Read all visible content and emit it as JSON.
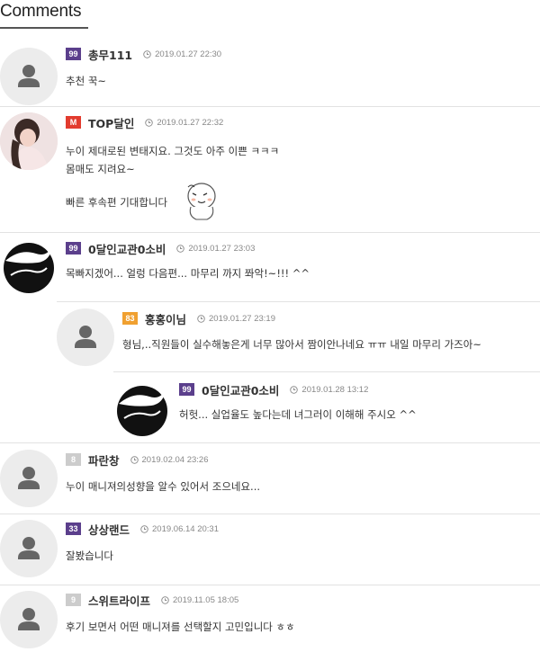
{
  "section": {
    "title": "Comments"
  },
  "colors": {
    "badge_level_99": "#5b3f8c",
    "badge_level_83": "#f0a030",
    "badge_level_8": "#cccccc",
    "badge_level_33": "#5b3f8c",
    "badge_level_9": "#cccccc",
    "badge_m": "#e23b2e"
  },
  "comments": [
    {
      "level": "99",
      "nick": "총무111",
      "date": "2019.01.27 22:30",
      "lines": [
        "추천 꾹~"
      ]
    },
    {
      "level": "M",
      "nick": "TOP달인",
      "date": "2019.01.27 22:32",
      "lines": [
        "누이 제대로된 변태지요. 그것도 아주 이쁜 ㅋㅋㅋ",
        "몸매도 지려요~",
        "빠른 후속편 기대합니다"
      ]
    },
    {
      "level": "99",
      "nick": "0달인교관0소비",
      "date": "2019.01.27 23:03",
      "lines": [
        "목빠지겠어... 얼렁 다음편... 마무리 까지 쫘악!~!!! ^^"
      ]
    },
    {
      "level": "83",
      "nick": "홍홍이님",
      "date": "2019.01.27 23:19",
      "lines": [
        "형님,..직원들이 실수해놓은게 너무 많아서 짬이안나네요 ㅠㅠ 내일 마무리 가즈아~"
      ]
    },
    {
      "level": "99",
      "nick": "0달인교관0소비",
      "date": "2019.01.28 13:12",
      "lines": [
        "허헛... 실업율도 높다는데 녀그러이 이해해 주시오 ^^"
      ]
    },
    {
      "level": "8",
      "nick": "파란창",
      "date": "2019.02.04 23:26",
      "lines": [
        "누이 매니져의성향을 알수 있어서 조으네요..."
      ]
    },
    {
      "level": "33",
      "nick": "상상랜드",
      "date": "2019.06.14 20:31",
      "lines": [
        "잘봤습니다"
      ]
    },
    {
      "level": "9",
      "nick": "스위트라이프",
      "date": "2019.11.05 18:05",
      "lines": [
        "후기 보면서 어떤 매니져를 선택할지 고민입니다 ㅎㅎ"
      ]
    }
  ]
}
